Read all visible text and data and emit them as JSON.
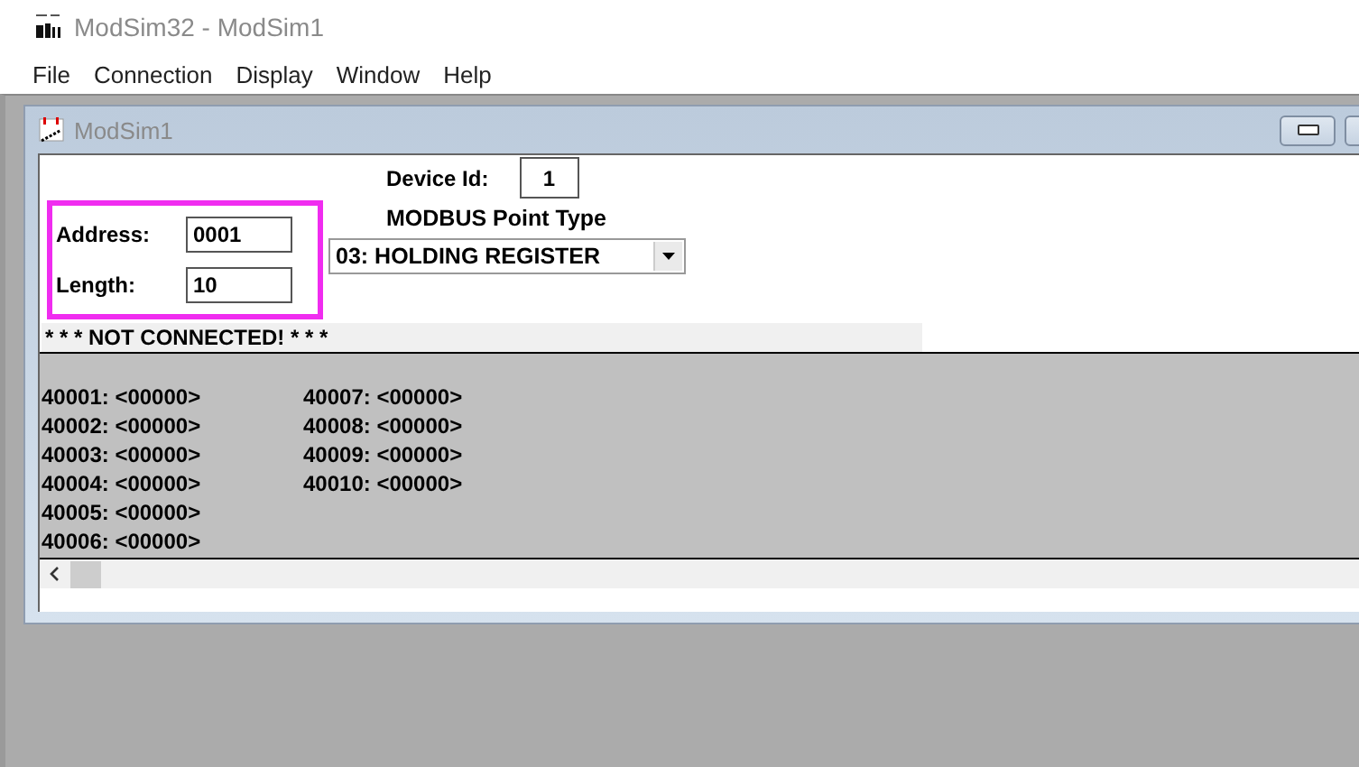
{
  "window": {
    "title": "ModSim32 - ModSim1"
  },
  "menu": [
    "File",
    "Connection",
    "Display",
    "Window",
    "Help"
  ],
  "child_window": {
    "title": "ModSim1",
    "device_id": {
      "label": "Device Id:",
      "value": "1"
    },
    "address": {
      "label": "Address:",
      "value": "0001"
    },
    "length": {
      "label": "Length:",
      "value": "10"
    },
    "point_type": {
      "label": "MODBUS Point Type",
      "value": "03: HOLDING REGISTER"
    },
    "status": "* * * NOT CONNECTED! * * *",
    "registers": [
      "40001: <00000>",
      "40002: <00000>",
      "40003: <00000>",
      "40004: <00000>",
      "40005: <00000>",
      "40006: <00000>",
      "40007: <00000>",
      "40008: <00000>",
      "40009: <00000>",
      "40010: <00000>"
    ]
  }
}
